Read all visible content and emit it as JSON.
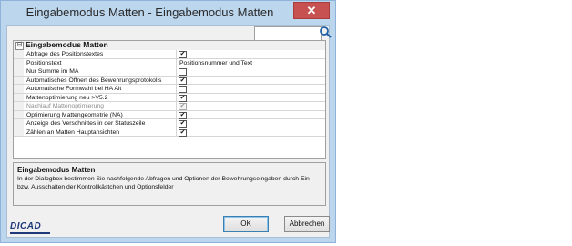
{
  "window": {
    "title": "Eingabemodus Matten - Eingabemodus Matten",
    "close_label": "✕"
  },
  "search": {
    "value": "",
    "placeholder": ""
  },
  "category": {
    "label": "Eingabemodus Matten",
    "expander": "⊟"
  },
  "properties": [
    {
      "name": "Abfrage des Positionstextes",
      "type": "checkbox",
      "checked": true,
      "disabled": false
    },
    {
      "name": "Positionstext",
      "type": "text",
      "value": "Positionsnummer und Text"
    },
    {
      "name": "Nur Summe im MA",
      "type": "checkbox",
      "checked": false,
      "disabled": false
    },
    {
      "name": "Automatisches Öffnen des Bewehrungsprotokolls",
      "type": "checkbox",
      "checked": true,
      "disabled": false
    },
    {
      "name": "Automatische Formwahl bei HA Alt",
      "type": "checkbox",
      "checked": false,
      "disabled": false
    },
    {
      "name": "Mattenoptimierung neu >V5.2",
      "type": "checkbox",
      "checked": true,
      "disabled": false
    },
    {
      "name": "Nachlauf Mattenoptimierung",
      "type": "checkbox",
      "checked": true,
      "disabled": true
    },
    {
      "name": "Optimierung Mattengeometrie (NA)",
      "type": "checkbox",
      "checked": true,
      "disabled": false
    },
    {
      "name": "Anzeige des Verschnittes in der Statuszeile",
      "type": "checkbox",
      "checked": true,
      "disabled": false
    },
    {
      "name": "Zählen an Matten Hauptansichten",
      "type": "checkbox",
      "checked": true,
      "disabled": false
    }
  ],
  "description": {
    "title": "Eingabemodus Matten",
    "text": "In der Dialogbox bestimmen Sie nachfolgende Abfragen und Optionen der Bewehrungseingaben durch Ein- bzw. Ausschalten der Kontrollkästchen und Optionsfelder"
  },
  "logo": {
    "text": "DICAD"
  },
  "buttons": {
    "ok": "OK",
    "cancel": "Abbrechen"
  },
  "colors": {
    "title_bar": "#bcd6ee",
    "close": "#c75050",
    "logo": "#1e3a7a"
  }
}
